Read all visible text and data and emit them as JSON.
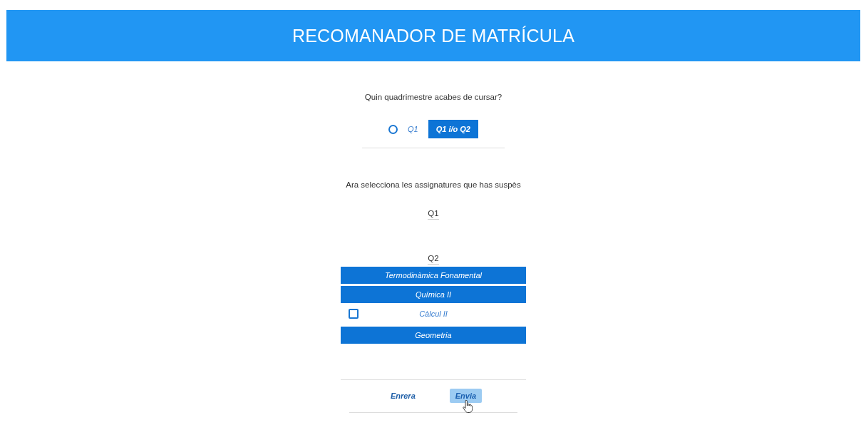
{
  "header": {
    "title": "RECOMANADOR DE MATRÍCULA"
  },
  "semester_question": {
    "prompt": "Quin quadrimestre acabes de cursar?",
    "options": [
      {
        "label": "Q1",
        "selected": false
      },
      {
        "label": "Q1 i/o Q2",
        "selected": true
      }
    ]
  },
  "subjects_section": {
    "prompt": "Ara selecciona les assignatures que has suspès",
    "groups": [
      {
        "heading": "Q1"
      },
      {
        "heading": "Q2",
        "subjects": [
          {
            "label": "Termodinàmica Fonamental",
            "selected": true
          },
          {
            "label": "Química II",
            "selected": true
          },
          {
            "label": "Càlcul II",
            "selected": false
          },
          {
            "label": "Geometria",
            "selected": true
          }
        ]
      }
    ]
  },
  "actions": [
    {
      "label": "Enrera",
      "hovered": false
    },
    {
      "label": "Envia",
      "hovered": true
    }
  ]
}
